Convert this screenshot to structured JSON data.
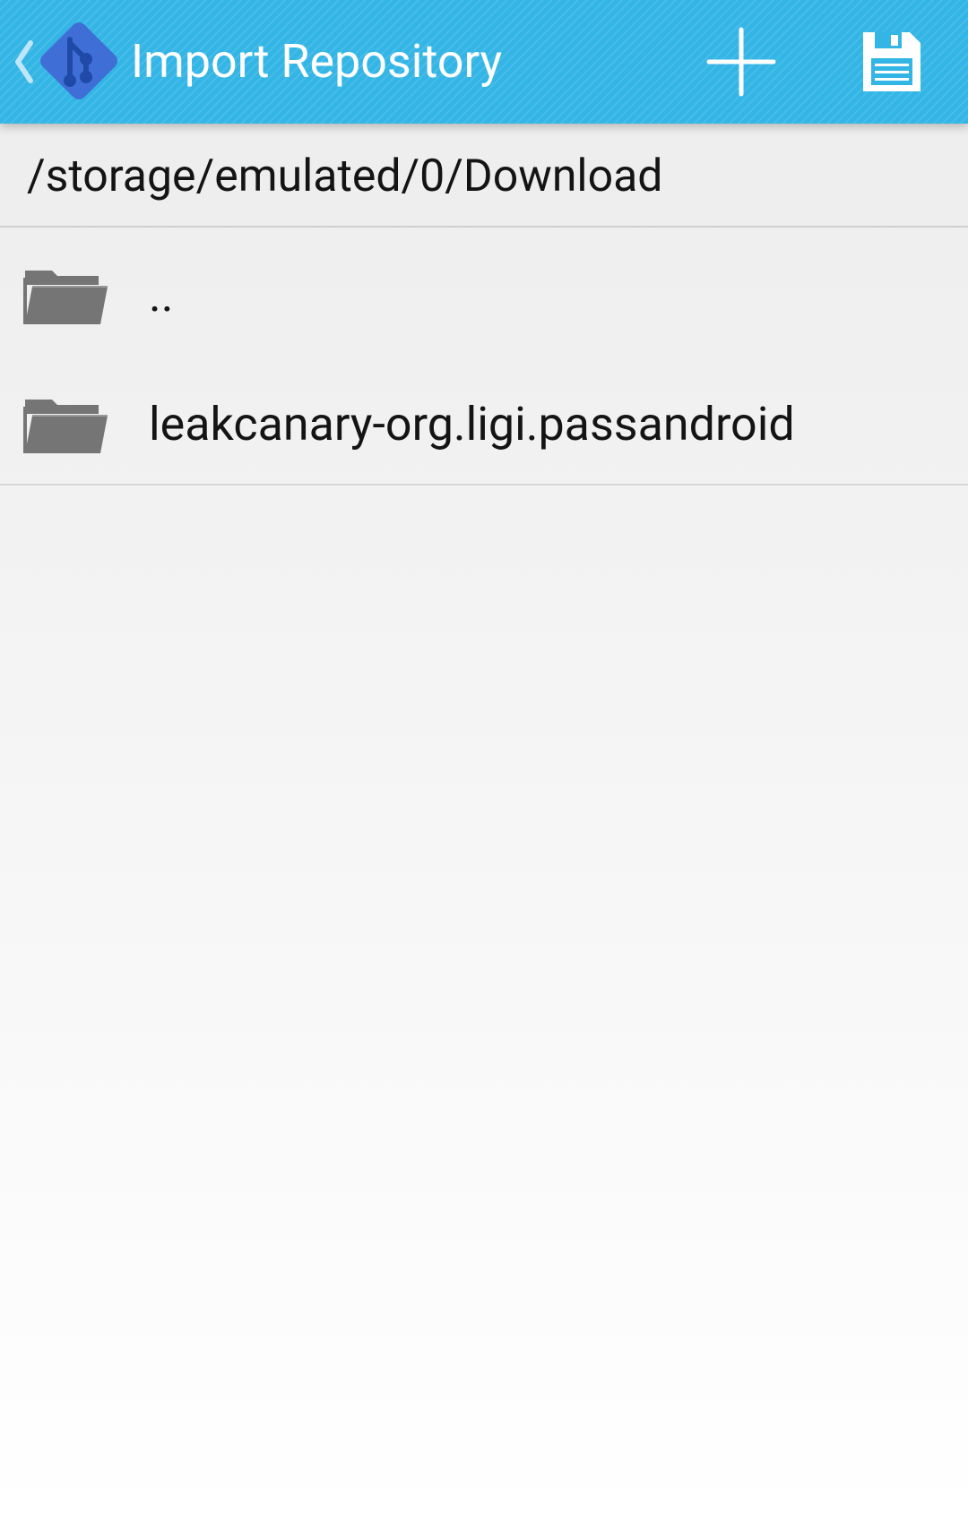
{
  "action_bar": {
    "title": "Import Repository",
    "up_icon": "chevron-left-icon",
    "logo_icon": "git-logo-icon",
    "add_icon": "plus-icon",
    "save_icon": "floppy-disk-icon",
    "background_color": "#33b5e5",
    "logo_color": "#3f6fd6"
  },
  "path": {
    "current": "/storage/emulated/0/Download"
  },
  "files": [
    {
      "name": "..",
      "icon": "folder-open-icon"
    },
    {
      "name": "leakcanary-org.ligi.passandroid",
      "icon": "folder-open-icon"
    }
  ],
  "colors": {
    "folder": "#757575",
    "text": "#141414",
    "divider": "#d0d0d0"
  }
}
